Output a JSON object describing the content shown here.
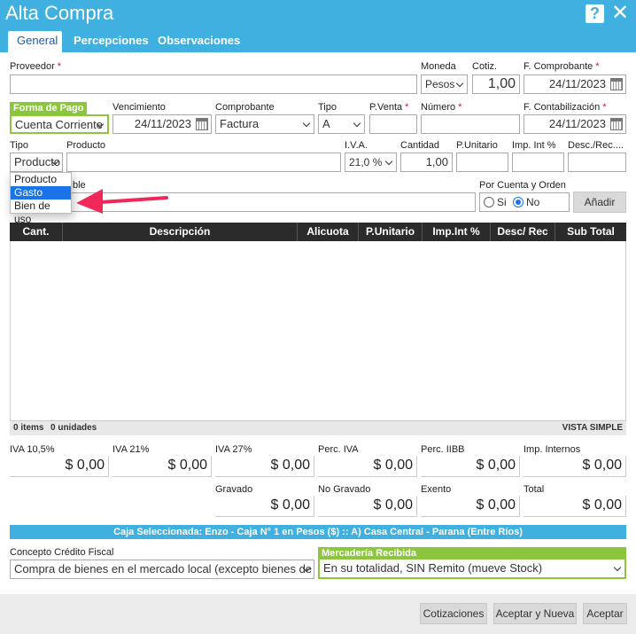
{
  "window": {
    "title": "Alta Compra",
    "help": "?",
    "close": "✕"
  },
  "tabs": [
    "General",
    "Percepciones",
    "Observaciones"
  ],
  "form": {
    "proveedor_label": "Proveedor",
    "moneda_label": "Moneda",
    "moneda_value": "Pesos",
    "cotiz_label": "Cotiz.",
    "cotiz_value": "1,00",
    "f_comprobante_label": "F. Comprobante",
    "f_comprobante_value": "24/11/2023",
    "forma_pago_label": "Forma de Pago",
    "forma_pago_value": "Cuenta Corriente",
    "vencimiento_label": "Vencimiento",
    "vencimiento_value": "24/11/2023",
    "comprobante_label": "Comprobante",
    "comprobante_value": "Factura",
    "tipo_label": "Tipo",
    "tipo_value": "A",
    "pventa_label": "P.Venta",
    "numero_label": "Número",
    "f_contab_label": "F. Contabilización",
    "f_contab_value": "24/11/2023",
    "item_tipo_label": "Tipo",
    "item_tipo_value": "Producto",
    "producto_label": "Producto",
    "iva_label": "I.V.A.",
    "iva_value": "21,0 %",
    "cantidad_label": "Cantidad",
    "cantidad_value": "1,00",
    "punitario_label": "P.Unitario",
    "impint_label": "Imp. Int %",
    "desc_label": "Desc./Rec....",
    "descripcion_label_partial": "ble",
    "por_cuenta_label": "Por Cuenta y Orden",
    "radio_si": "Si",
    "radio_no": "No",
    "anadir": "Añadir"
  },
  "dropdown": {
    "options": [
      "Producto",
      "Gasto",
      "Bien de uso"
    ],
    "selected": "Gasto"
  },
  "grid": {
    "columns": [
      "Cant.",
      "Descripción",
      "Alicuota",
      "P.Unitario",
      "Imp.Int %",
      "Desc/ Rec",
      "Sub Total"
    ],
    "items_count": "0 items",
    "units_count": "0 unidades",
    "view_mode": "VISTA SIMPLE"
  },
  "totals": {
    "row1": [
      {
        "label": "IVA 10,5%",
        "value": "$ 0,00"
      },
      {
        "label": "IVA 21%",
        "value": "$ 0,00"
      },
      {
        "label": "IVA 27%",
        "value": "$ 0,00"
      },
      {
        "label": "Perc. IVA",
        "value": "$ 0,00"
      },
      {
        "label": "Perc. IIBB",
        "value": "$ 0,00"
      },
      {
        "label": "Imp. Internos",
        "value": "$ 0,00"
      }
    ],
    "row2": [
      {
        "label": "Gravado",
        "value": "$ 0,00"
      },
      {
        "label": "No Gravado",
        "value": "$ 0,00"
      },
      {
        "label": "Exento",
        "value": "$ 0,00"
      },
      {
        "label": "Total",
        "value": "$ 0,00"
      }
    ]
  },
  "caja": "Caja Seleccionada: Enzo - Caja N° 1 en Pesos ($) :: A) Casa Central - Parana (Entre Ríos)",
  "concepto": {
    "label": "Concepto Crédito Fiscal",
    "value": "Compra de bienes en el mercado local (excepto bienes de uso)"
  },
  "mercaderia": {
    "label": "Mercadería Recibida",
    "value": "En su totalidad, SIN Remito (mueve Stock)"
  },
  "buttons": {
    "cotizaciones": "Cotizaciones",
    "aceptar_nueva": "Aceptar y Nueva",
    "aceptar": "Aceptar"
  },
  "colors": {
    "header": "#3fb0e0",
    "accent_green": "#8cc63e",
    "required": "#d0143a",
    "arrow": "#f0285a"
  }
}
